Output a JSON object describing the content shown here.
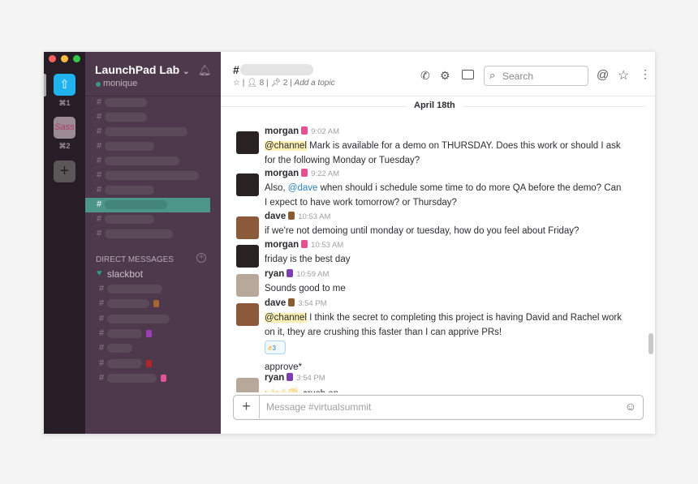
{
  "window": {
    "lights": [
      "#fc605c",
      "#fdbc40",
      "#34c84a"
    ]
  },
  "teams": [
    {
      "shortcut": "⌘1",
      "color": "#1fb3f0"
    },
    {
      "shortcut": "⌘2",
      "color": "#9b8a92"
    }
  ],
  "add_team": "+",
  "sidebar": {
    "team_name": "LaunchPad Lab",
    "team_chevron": "⌄",
    "username": "monique",
    "channels_count_active_index": 7,
    "direct_messages_label": "DIRECT MESSAGES",
    "slackbot": "slackbot"
  },
  "header": {
    "hash": "#",
    "members": "8",
    "pins": "2",
    "add_topic": "Add a topic",
    "search_placeholder": "Search"
  },
  "date_divider": "April 18th",
  "messages": [
    {
      "user": "morgan",
      "time": "9:02 AM",
      "mention": "@channel",
      "text": " Mark is available for a demo on THURSDAY. Does this work or should I ask for the following Monday or Tuesday?"
    },
    {
      "user": "morgan",
      "time": "9:22 AM",
      "pre": "Also, ",
      "mention": "@dave",
      "text": " when should i schedule some time to do more QA before the demo? Can I expect to have work tomorrow? or Thursday?"
    },
    {
      "user": "dave",
      "time": "10:53 AM",
      "text": "if we're not demoing until monday or tuesday, how do you feel about Friday?"
    },
    {
      "user": "morgan",
      "time": "10:53 AM",
      "text": "friday is the best day"
    },
    {
      "user": "ryan",
      "time": "10:59 AM",
      "text": "Sounds good to me"
    },
    {
      "user": "dave",
      "time": "3:54 PM",
      "mention": "@channel",
      "text": " I think the secret to completing this project is having David and Rachel work on it, they are crushing this faster than I can apprive PRs!",
      "reaction_count": "3",
      "followup": "approve*"
    },
    {
      "user": "ryan",
      "time": "3:54 PM",
      "text": "crush on"
    }
  ],
  "composer": {
    "placeholder": "Message #virtualsummit"
  }
}
